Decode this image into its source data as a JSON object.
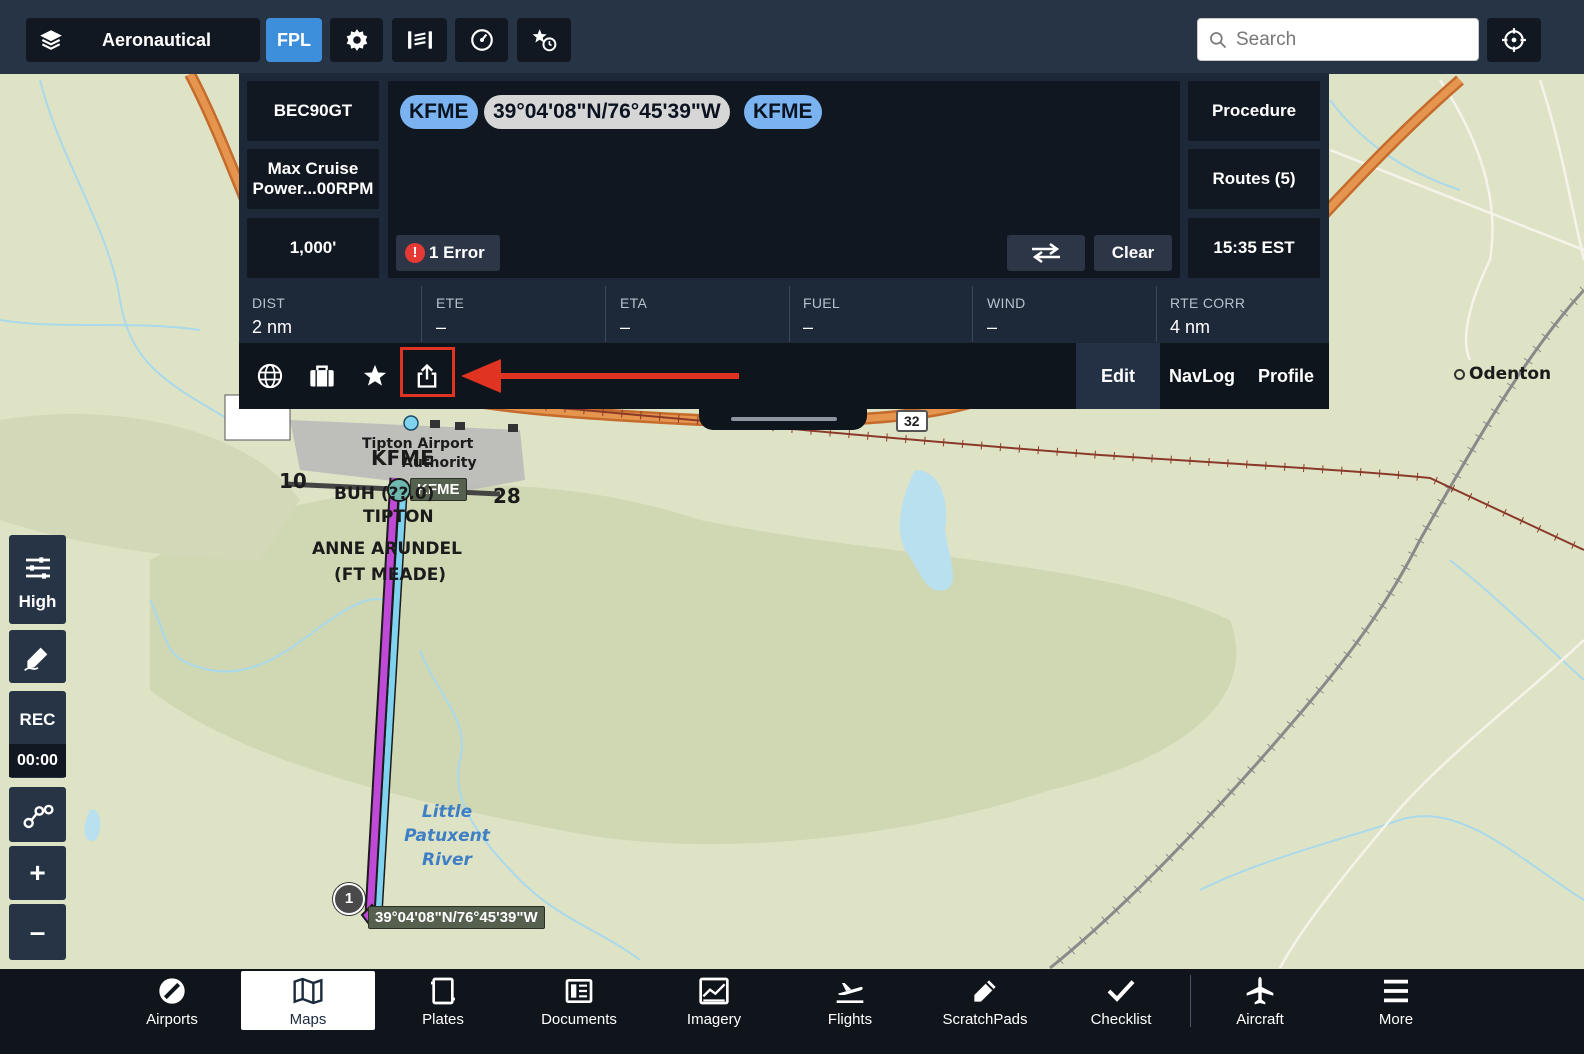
{
  "topbar": {
    "layers_label": "Aeronautical",
    "fpl_label": "FPL",
    "search_placeholder": "Search"
  },
  "flight_plan": {
    "aircraft": "BEC90GT",
    "power_setting": "Max Cruise Power...00RPM",
    "altitude": "1,000'",
    "waypoints": [
      {
        "id": "KFME",
        "kind": "airport"
      },
      {
        "id": "39°04'08\"N/76°45'39\"W",
        "kind": "coordinate"
      },
      {
        "id": "KFME",
        "kind": "airport"
      }
    ],
    "error_label": "1 Error",
    "error_badge": "!",
    "clear_label": "Clear",
    "procedure_label": "Procedure",
    "routes_label": "Routes (5)",
    "time_label": "15:35 EST",
    "stats": [
      {
        "key": "DIST",
        "value": "2 nm"
      },
      {
        "key": "ETE",
        "value": "–"
      },
      {
        "key": "ETA",
        "value": "–"
      },
      {
        "key": "FUEL",
        "value": "–"
      },
      {
        "key": "WIND",
        "value": "–"
      },
      {
        "key": "RTE CORR",
        "value": "4 nm"
      }
    ],
    "edit_label": "Edit",
    "navlog_label": "NavLog",
    "profile_label": "Profile"
  },
  "map": {
    "airport_name": "Tipton Airport",
    "airport_authority": "Authority",
    "airport_id": "KFME",
    "airport_tag": "KFME",
    "runway_10": "10",
    "runway_28": "28",
    "buh_label": "BUH (??.0)",
    "tipton_label": "TIPTON",
    "anne_arundel_line1": "ANNE ARUNDEL",
    "anne_arundel_line2": "(FT MEADE)",
    "river_line1": "Little Patuxent",
    "river_line2": "River",
    "odenton_label": "Odenton",
    "route_shield": "32",
    "waypoint_seq": "1",
    "waypoint_coord_tag": "39°04'08\"N/76°45'39\"W",
    "colors": {
      "route": "#c04ad8",
      "route_track": "#7fd3ef",
      "highway": "#d9823a",
      "border": "#8b3a2a"
    }
  },
  "side_tools": {
    "detail_level": "High",
    "rec_label": "REC",
    "rec_time": "00:00",
    "zoom_in": "+",
    "zoom_out": "–"
  },
  "tabs": [
    {
      "label": "Airports",
      "icon": "airports-icon"
    },
    {
      "label": "Maps",
      "icon": "maps-icon",
      "active": true
    },
    {
      "label": "Plates",
      "icon": "plates-icon"
    },
    {
      "label": "Documents",
      "icon": "documents-icon"
    },
    {
      "label": "Imagery",
      "icon": "imagery-icon"
    },
    {
      "label": "Flights",
      "icon": "flights-icon"
    },
    {
      "label": "ScratchPads",
      "icon": "scratchpads-icon"
    },
    {
      "label": "Checklist",
      "icon": "checklist-icon"
    },
    {
      "label": "Aircraft",
      "icon": "aircraft-icon"
    },
    {
      "label": "More",
      "icon": "more-icon"
    }
  ]
}
